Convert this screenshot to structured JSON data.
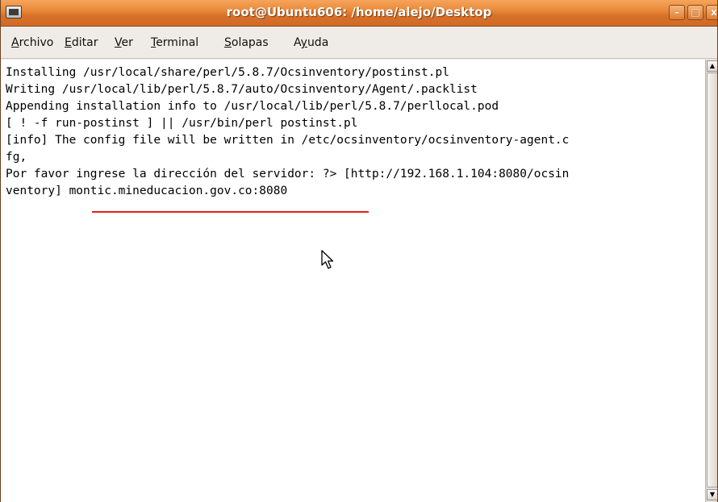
{
  "window": {
    "title": "root@Ubuntu606: /home/alejo/Desktop",
    "buttons": {
      "minimize": "–",
      "maximize": "□",
      "close": "x"
    }
  },
  "menu": [
    {
      "mnemonic": "A",
      "rest": "rchivo"
    },
    {
      "mnemonic": "E",
      "rest": "ditar"
    },
    {
      "mnemonic": "V",
      "rest": "er"
    },
    {
      "mnemonic": "T",
      "rest": "erminal"
    },
    {
      "mnemonic": "S",
      "rest": "olapas"
    },
    {
      "pre": "A",
      "mnemonic": "y",
      "rest": "uda"
    }
  ],
  "terminal": {
    "lines": [
      "Installing /usr/local/share/perl/5.8.7/Ocsinventory/postinst.pl",
      "Writing /usr/local/lib/perl/5.8.7/auto/Ocsinventory/Agent/.packlist",
      "Appending installation info to /usr/local/lib/perl/5.8.7/perllocal.pod",
      "[ ! -f run-postinst ] || /usr/bin/perl postinst.pl",
      "[info] The config file will be written in /etc/ocsinventory/ocsinventory-agent.c",
      "fg,",
      "Por favor ingrese la dirección del servidor: ?> [http://192.168.1.104:8080/ocsin",
      "ventory] montic.mineducacion.gov.co:8080"
    ]
  },
  "colors": {
    "titlebar": "#e98a3a",
    "highlight_underline": "#e02020",
    "terminal_bg": "#ffffff",
    "terminal_fg": "#000000"
  }
}
